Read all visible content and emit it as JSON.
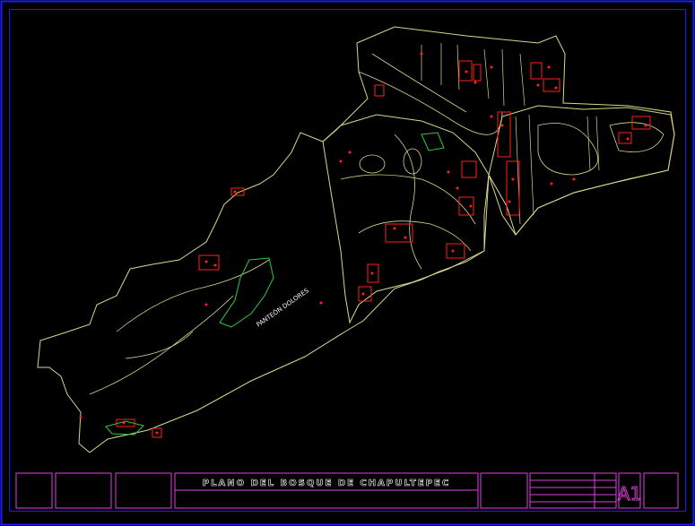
{
  "drawing": {
    "title": "PLANO DEL BOSQUE DE CHAPULTEPEC",
    "sheet_size": "A1",
    "colors": {
      "background": "#000000",
      "outer_border": "#1a1aff",
      "title_block": "#e040e0",
      "boundary_lines": "#d8d88a",
      "buildings": "#ff2020",
      "vegetation": "#2ecc40",
      "labels": "#ffffff"
    }
  },
  "map_labels": {
    "panteon": "PANTEÓN DOLORES"
  }
}
